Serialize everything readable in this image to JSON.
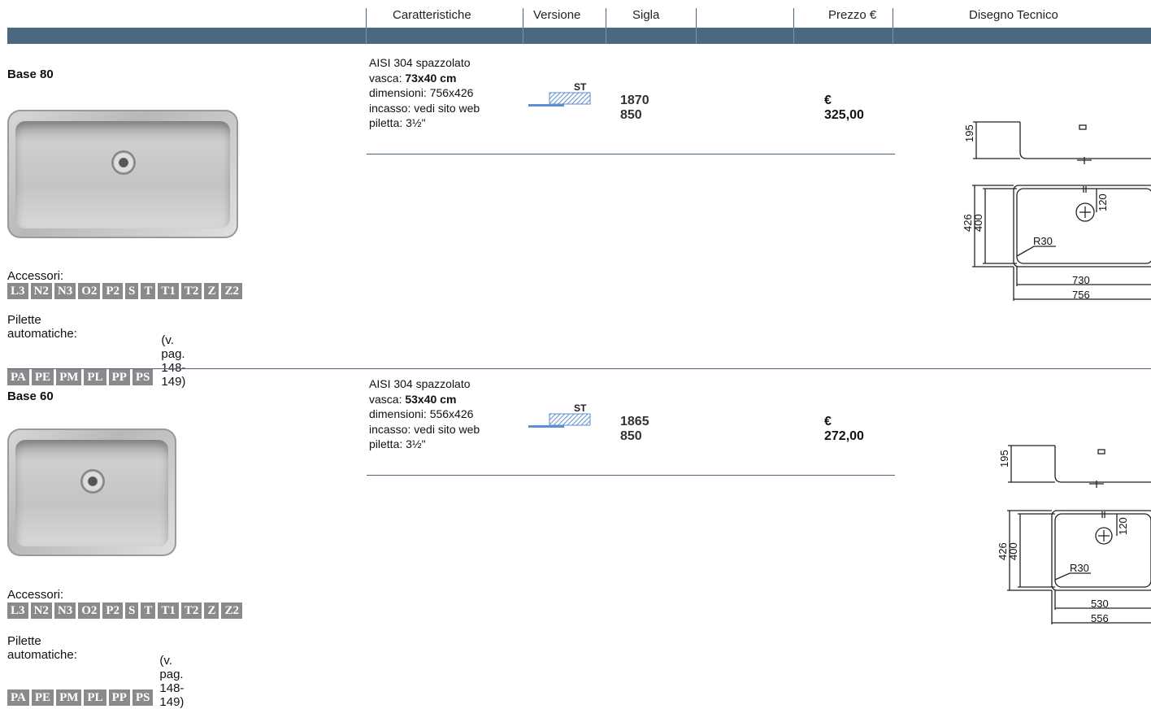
{
  "header": {
    "caratteristiche": "Caratteristiche",
    "versione": "Versione",
    "sigla": "Sigla",
    "prezzo": "Prezzo €",
    "disegno": "Disegno Tecnico"
  },
  "products": [
    {
      "title": "Base 80",
      "material": "AISI 304 spazzolato",
      "vasca_label": "vasca: ",
      "vasca_value": "73x40 cm",
      "dimensioni": "dimensioni: 756x426",
      "incasso": "incasso: vedi sito web",
      "piletta": "piletta: 3½\"",
      "version": "ST",
      "code": "1870 850",
      "price": "€ 325,00",
      "accessori_label": "Accessori:",
      "accessori": [
        "L3",
        "N2",
        "N3",
        "O2",
        "P2",
        "S",
        "T",
        "T1",
        "T2",
        "Z",
        "Z2"
      ],
      "pilette_label": "Pilette automatiche:",
      "pilette": [
        "PA",
        "PE",
        "PM",
        "PL",
        "PP",
        "PS"
      ],
      "pilette_ref": "(v. pag. 148-149)",
      "drawing": {
        "h": "195",
        "outer_h": "426",
        "inner_h": "400",
        "drain": "120",
        "radius": "R30",
        "inner_w": "730",
        "outer_w": "756"
      }
    },
    {
      "title": "Base 60",
      "material": "AISI 304 spazzolato",
      "vasca_label": "vasca: ",
      "vasca_value": "53x40 cm",
      "dimensioni": "dimensioni: 556x426",
      "incasso": "incasso: vedi sito web",
      "piletta": "piletta: 3½\"",
      "version": "ST",
      "code": "1865 850",
      "price": "€ 272,00",
      "accessori_label": "Accessori:",
      "accessori": [
        "L3",
        "N2",
        "N3",
        "O2",
        "P2",
        "S",
        "T",
        "T1",
        "T2",
        "Z",
        "Z2"
      ],
      "pilette_label": "Pilette automatiche:",
      "pilette": [
        "PA",
        "PE",
        "PM",
        "PL",
        "PP",
        "PS"
      ],
      "pilette_ref": "(v. pag. 148-149)",
      "drawing": {
        "h": "195",
        "outer_h": "426",
        "inner_h": "400",
        "drain": "120",
        "radius": "R30",
        "inner_w": "530",
        "outer_w": "556"
      }
    }
  ],
  "colors": {
    "header_bar": "#4b6883",
    "badge": "#8a8a8a",
    "version_icon": "#5b8fd0"
  }
}
